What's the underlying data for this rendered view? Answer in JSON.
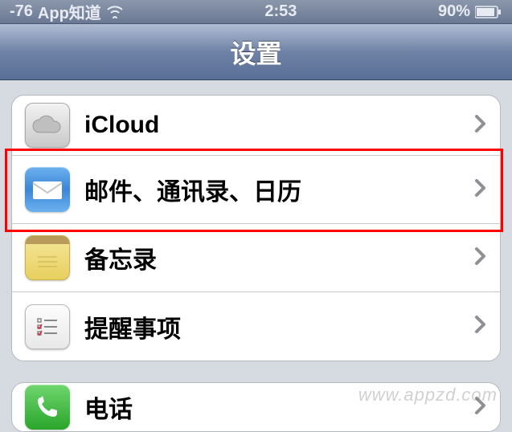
{
  "statusbar": {
    "signal": "-76",
    "carrier": "App知道",
    "time": "2:53",
    "battery_pct": "90%"
  },
  "nav": {
    "title": "设置"
  },
  "rows": {
    "icloud": {
      "label": "iCloud"
    },
    "mail": {
      "label": "邮件、通讯录、日历"
    },
    "notes": {
      "label": "备忘录"
    },
    "reminders": {
      "label": "提醒事项"
    },
    "phone": {
      "label": "电话"
    }
  },
  "watermark": "www.appzd.com"
}
